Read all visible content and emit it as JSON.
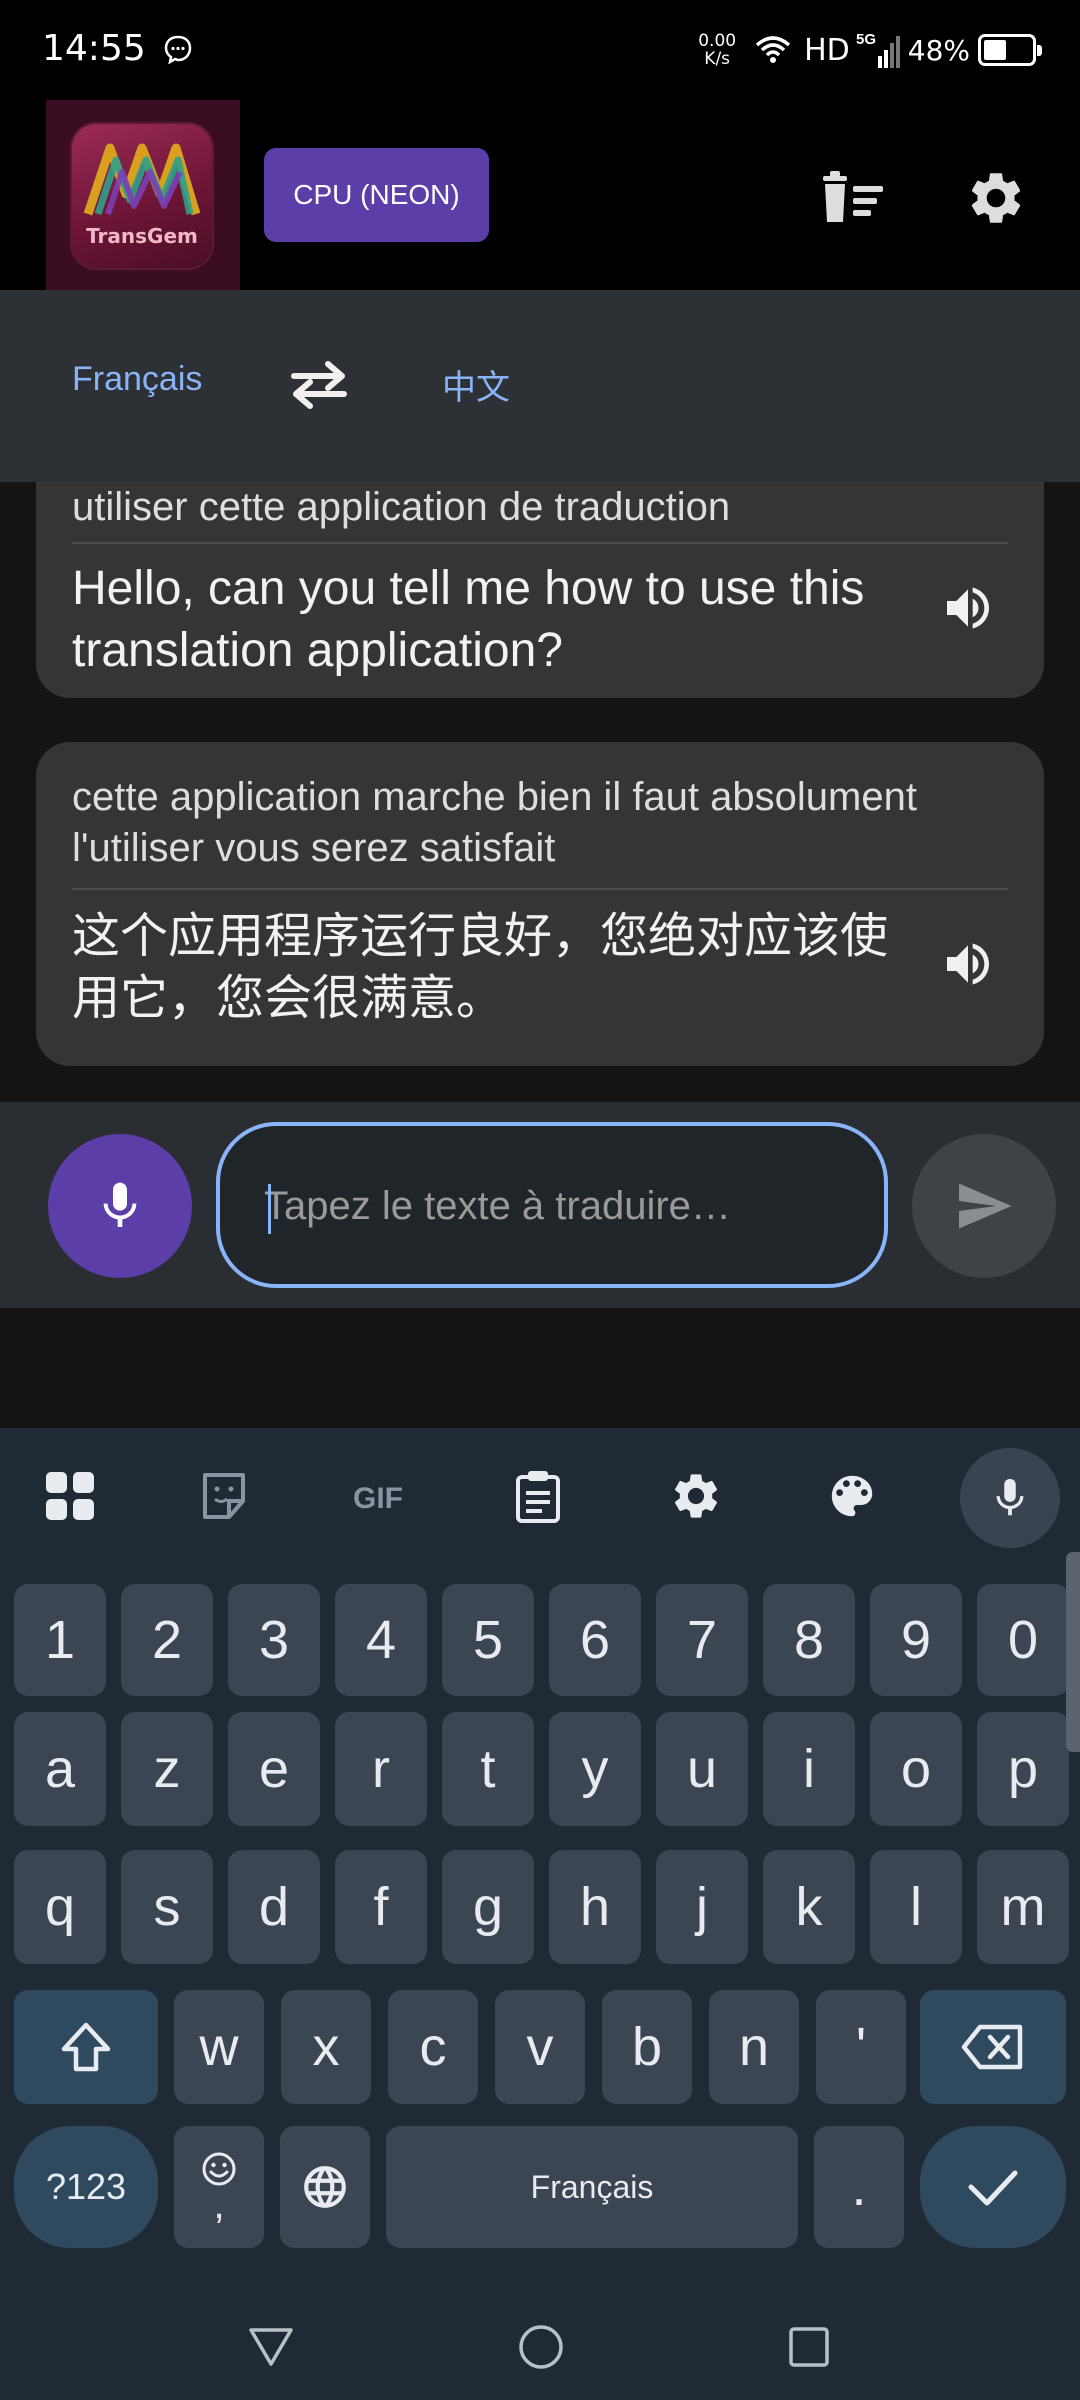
{
  "status_bar": {
    "time": "14:55",
    "net_speed_value": "0.00",
    "net_speed_unit": "K/s",
    "hd": "HD",
    "network": "5G",
    "battery_text": "48%",
    "battery_level": 0.48
  },
  "app_bar": {
    "logo_text": "TransGem",
    "cpu_badge": "CPU (NEON)",
    "icons": [
      "clear-history-icon",
      "settings-icon"
    ]
  },
  "language_bar": {
    "source_language": "Français",
    "target_language": "中文",
    "swap_icon": "swap-arrows-icon"
  },
  "conversation": {
    "messages": [
      {
        "source": "utiliser cette application de traduction",
        "translation": "Hello, can you tell me how to use this translation application?"
      },
      {
        "source": "cette application marche bien il faut absolument l'utiliser vous serez satisfait",
        "translation": "这个应用程序运行良好，您绝对应该使用它，您会很满意。"
      }
    ]
  },
  "input": {
    "placeholder": "Tapez le texte à traduire…",
    "value": ""
  },
  "keyboard": {
    "toolbar": [
      "apps-grid-icon",
      "sticker-icon",
      "gif-icon",
      "clipboard-icon",
      "settings-icon",
      "palette-icon",
      "mic-icon"
    ],
    "gif_label": "GIF",
    "row_numbers": [
      "1",
      "2",
      "3",
      "4",
      "5",
      "6",
      "7",
      "8",
      "9",
      "0"
    ],
    "row_1": [
      "a",
      "z",
      "e",
      "r",
      "t",
      "y",
      "u",
      "i",
      "o",
      "p"
    ],
    "row_2": [
      "q",
      "s",
      "d",
      "f",
      "g",
      "h",
      "j",
      "k",
      "l",
      "m"
    ],
    "row_3": [
      "w",
      "x",
      "c",
      "v",
      "b",
      "n",
      "'"
    ],
    "symbols_key": "?123",
    "emoji_comma": ",",
    "space_label": "Français",
    "period": "."
  },
  "colors": {
    "accent_purple": "#5c3ea8",
    "accent_blue": "#8ab4f8",
    "card_bg": "#353535",
    "keyboard_bg": "#1f2a35"
  }
}
